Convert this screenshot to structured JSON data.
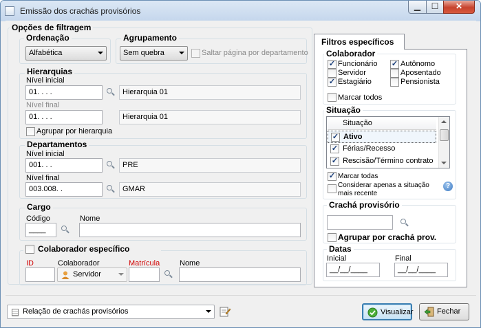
{
  "window": {
    "title": "Emissão dos crachás provisórios"
  },
  "left": {
    "group_title": "Opções de filtragem",
    "ordenacao": {
      "title": "Ordenação",
      "value": "Alfabética"
    },
    "agrupamento": {
      "title": "Agrupamento",
      "value": "Sem quebra",
      "saltar_label": "Saltar página por departamento"
    },
    "hierarquias": {
      "title": "Hierarquias",
      "inicial_label": "Nível inicial",
      "inicial_value": "01.   .   .   .",
      "inicial_desc": "Hierarquia 01",
      "final_label": "Nível final",
      "final_value": "01.   .   .   .",
      "final_desc": "Hierarquia 01",
      "agrupar_label": "Agrupar por hierarquia"
    },
    "departamentos": {
      "title": "Departamentos",
      "inicial_label": "Nível inicial",
      "inicial_value": "001.   .   .",
      "inicial_desc": "PRE",
      "final_label": "Nível final",
      "final_value": "003.008.   .",
      "final_desc": "GMAR"
    },
    "cargo": {
      "title": "Cargo",
      "codigo_label": "Código",
      "codigo_value": "____",
      "nome_label": "Nome"
    },
    "colaborador": {
      "title": "Colaborador específico",
      "id_label": "ID",
      "colaborador_label": "Colaborador",
      "colaborador_value": "Servidor",
      "matricula_label": "Matrícula",
      "nome_label": "Nome"
    }
  },
  "right": {
    "tab_label": "Filtros específicos",
    "colaborador": {
      "title": "Colaborador",
      "options": [
        {
          "label": "Funcionário",
          "checked": true
        },
        {
          "label": "Autônomo",
          "checked": true
        },
        {
          "label": "Servidor",
          "checked": false
        },
        {
          "label": "Aposentado",
          "checked": false
        },
        {
          "label": "Estagiário",
          "checked": true
        },
        {
          "label": "Pensionista",
          "checked": false
        }
      ],
      "marcar_todos_label": "Marcar todos"
    },
    "situacao": {
      "title": "Situação",
      "column_header": "Situação",
      "rows": [
        {
          "label": "Ativo",
          "checked": true
        },
        {
          "label": "Férias/Recesso",
          "checked": true
        },
        {
          "label": "Rescisão/Término contrato",
          "checked": true
        }
      ],
      "marcar_todas_label": "Marcar todas",
      "considerar_label_1": "Considerar apenas a situação",
      "considerar_label_2": "mais recente"
    },
    "cracha": {
      "title": "Crachá provisório",
      "agrupar_label": "Agrupar por crachá prov."
    },
    "datas": {
      "title": "Datas",
      "inicial_label": "Inicial",
      "inicial_value": "__/__/____",
      "final_label": "Final",
      "final_value": "__/__/____"
    }
  },
  "footer": {
    "report_value": "Relação de crachás provisórios",
    "visualizar_label": "Visualizar",
    "fechar_label": "Fechar"
  },
  "colors": {
    "check_mark": "#1a3e7a",
    "required_label": "#d00000",
    "default_button_border": "#3c7fb1"
  }
}
